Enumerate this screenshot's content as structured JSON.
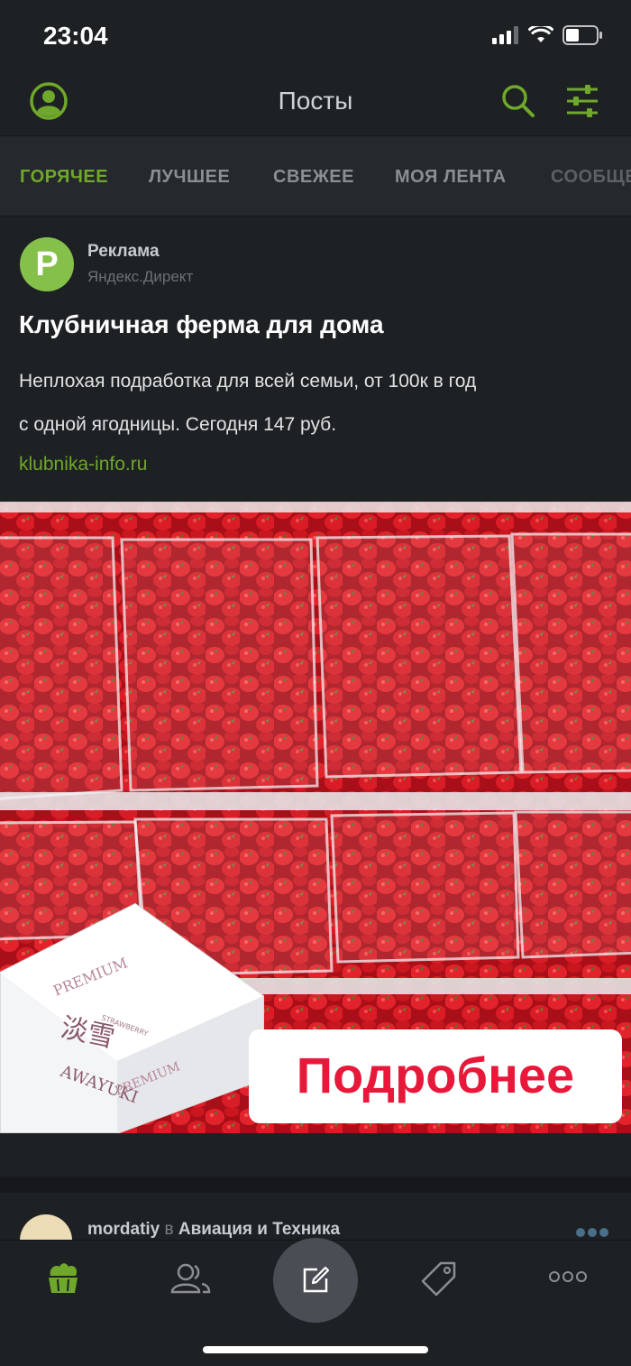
{
  "status_bar": {
    "time": "23:04"
  },
  "header": {
    "title": "Посты"
  },
  "tabs": [
    {
      "label": "ГОРЯЧЕЕ",
      "active": true
    },
    {
      "label": "ЛУЧШЕЕ",
      "active": false
    },
    {
      "label": "СВЕЖЕЕ",
      "active": false
    },
    {
      "label": "МОЯ ЛЕНТА",
      "active": false
    },
    {
      "label": "СООБЩЕ",
      "active": false
    }
  ],
  "ad_post": {
    "avatar_letter": "Р",
    "label": "Реклама",
    "source": "Яндекс.Директ",
    "title": "Клубничная ферма для дома",
    "text_line1": "Неплохая подработка для всей семьи, от 100к в год",
    "text_line2": "с одной ягодницы. Сегодня 147 руб.",
    "link": "klubnika-info.ru",
    "image": {
      "button_text": "Подробнее",
      "box_text_premium": "PREMIUM",
      "box_text_kanji": "淡雪",
      "box_text_brand": "AWAYUKI",
      "box_text_small": "STRAWBERRY"
    }
  },
  "next_post": {
    "author": "mordatiy",
    "in_word": "в",
    "community": "Авиация и Техника"
  },
  "colors": {
    "accent": "#6fa82a",
    "background": "#1e2124",
    "ad_avatar": "#85c04a"
  },
  "icons": [
    "profile-icon",
    "search-icon",
    "filter-icon",
    "home-icon",
    "community-icon",
    "compose-icon",
    "tag-icon",
    "more-icon"
  ]
}
